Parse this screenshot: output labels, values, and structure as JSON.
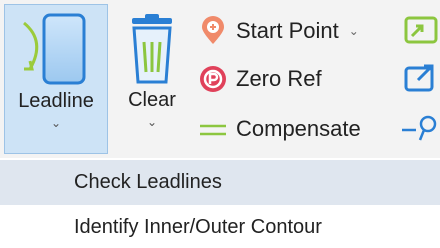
{
  "ribbon": {
    "leadline": {
      "label": "Leadline",
      "icon": "leadline-icon",
      "chevron": "⌄"
    },
    "clear": {
      "label": "Clear",
      "icon": "trash-icon",
      "chevron": "⌄"
    },
    "start_point": {
      "label": "Start Point",
      "icon": "start-point-icon",
      "chevron": "⌄"
    },
    "zero_ref": {
      "label": "Zero Ref",
      "icon": "zero-ref-icon"
    },
    "compensate": {
      "label": "Compensate",
      "icon": "compensate-icon"
    }
  },
  "menu": {
    "items": [
      {
        "label": "Check Leadlines",
        "highlighted": true
      },
      {
        "label": "Identify Inner/Outer Contour",
        "highlighted": false
      }
    ]
  },
  "colors": {
    "accent_blue": "#2a7fd4",
    "highlight": "#cde3f6",
    "red_icon": "#e0415a",
    "green_icon": "#5cb85c"
  }
}
